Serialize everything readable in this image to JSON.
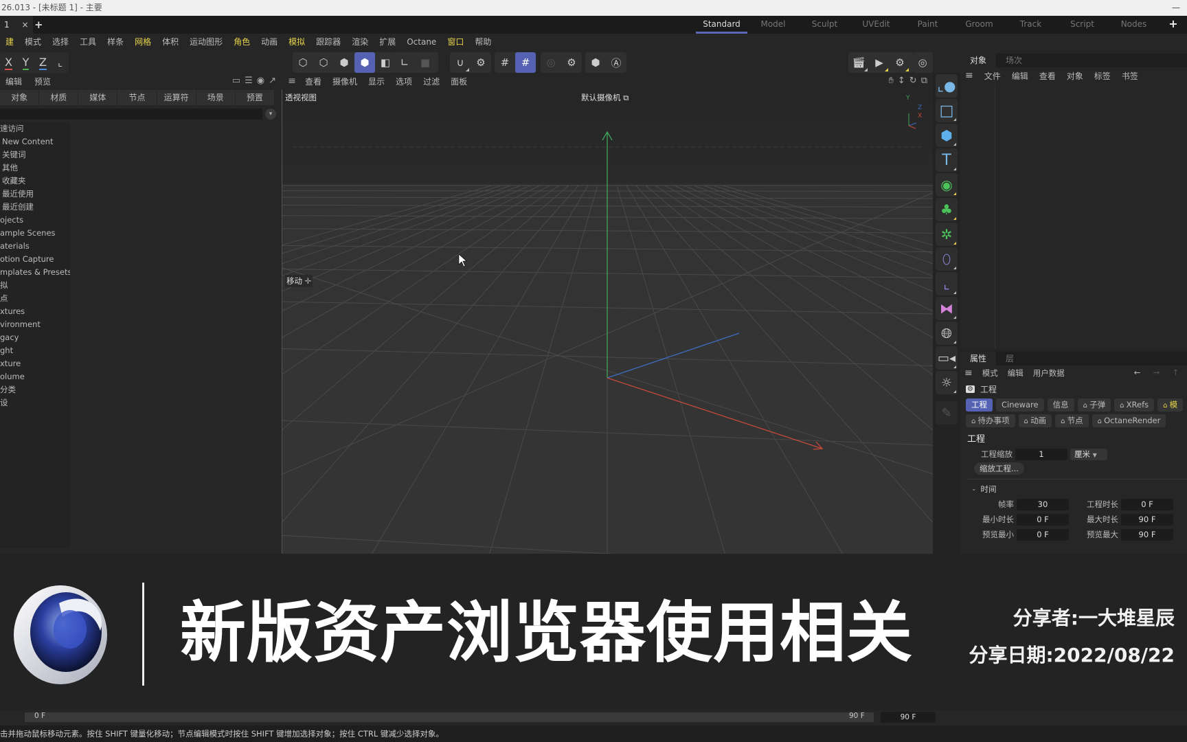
{
  "window": {
    "title": "26.013 - [未标题 1] - 主要",
    "minimize_glyph": "—"
  },
  "doc_tabs": {
    "active_label": "1",
    "close_glyph": "×",
    "add_glyph": "+"
  },
  "layouts": {
    "items": [
      "Standard",
      "Model",
      "Sculpt",
      "UVEdit",
      "Paint",
      "Groom",
      "Track",
      "Script",
      "Nodes"
    ],
    "active": "Standard",
    "add_glyph": "+"
  },
  "menubar": {
    "items": [
      {
        "label": "建",
        "highlight": true
      },
      {
        "label": "模式",
        "highlight": false
      },
      {
        "label": "选择",
        "highlight": false
      },
      {
        "label": "工具",
        "highlight": false
      },
      {
        "label": "样条",
        "highlight": false
      },
      {
        "label": "网格",
        "highlight": true
      },
      {
        "label": "体积",
        "highlight": false
      },
      {
        "label": "运动图形",
        "highlight": false
      },
      {
        "label": "角色",
        "highlight": true
      },
      {
        "label": "动画",
        "highlight": false
      },
      {
        "label": "模拟",
        "highlight": true
      },
      {
        "label": "跟踪器",
        "highlight": false
      },
      {
        "label": "渲染",
        "highlight": false
      },
      {
        "label": "扩展",
        "highlight": false
      },
      {
        "label": "Octane",
        "highlight": false
      },
      {
        "label": "窗口",
        "highlight": true
      },
      {
        "label": "帮助",
        "highlight": false
      }
    ]
  },
  "toolbar": {
    "axis_x": "X",
    "axis_y": "Y",
    "axis_z": "Z",
    "colors": {
      "x": "#d9534f",
      "y": "#4caf50",
      "z": "#4a8fe0",
      "accent": "#5562b3",
      "highlight": "#e6d24a"
    }
  },
  "asset_browser": {
    "menu": [
      "编辑",
      "预览"
    ],
    "tabs": [
      "对象",
      "材质",
      "媒体",
      "节点",
      "运算符",
      "场景",
      "预置"
    ],
    "search_placeholder": "",
    "tree": [
      {
        "label": "速访问",
        "indent": false
      },
      {
        "label": "New Content",
        "indent": true
      },
      {
        "label": "关键词",
        "indent": true
      },
      {
        "label": "其他",
        "indent": true
      },
      {
        "label": "收藏夹",
        "indent": true
      },
      {
        "label": "最近使用",
        "indent": true
      },
      {
        "label": "最近创建",
        "indent": true
      },
      {
        "label": "ojects",
        "indent": false
      },
      {
        "label": "ample Scenes",
        "indent": false
      },
      {
        "label": "aterials",
        "indent": false
      },
      {
        "label": "otion Capture",
        "indent": false
      },
      {
        "label": "mplates & Presets",
        "indent": false
      },
      {
        "label": "拟",
        "indent": false
      },
      {
        "label": "点",
        "indent": false
      },
      {
        "label": "xtures",
        "indent": false
      },
      {
        "label": "vironment",
        "indent": false
      },
      {
        "label": "gacy",
        "indent": false
      },
      {
        "label": "ght",
        "indent": false
      },
      {
        "label": "xture",
        "indent": false
      },
      {
        "label": "olume",
        "indent": false
      },
      {
        "label": "分类",
        "indent": false
      },
      {
        "label": "设",
        "indent": false
      }
    ]
  },
  "viewport": {
    "menu": [
      "查看",
      "摄像机",
      "显示",
      "选项",
      "过滤",
      "面板"
    ],
    "view_name": "透视视图",
    "camera": "默认摄像机",
    "tool_hint": "移动",
    "gizmo": {
      "y": "Y",
      "z": "Z",
      "x": "X"
    }
  },
  "object_manager": {
    "tabs": [
      "对象",
      "场次"
    ],
    "menu": [
      "文件",
      "编辑",
      "查看",
      "对象",
      "标签",
      "书签"
    ]
  },
  "attributes": {
    "tabs": [
      "属性",
      "层"
    ],
    "menu": [
      "模式",
      "编辑",
      "用户数据"
    ],
    "object_name": "工程",
    "chips_row1": [
      {
        "label": "工程",
        "active": true,
        "locked": false
      },
      {
        "label": "Cineware",
        "active": false,
        "locked": false
      },
      {
        "label": "信息",
        "active": false,
        "locked": false
      },
      {
        "label": "子弹",
        "active": false,
        "locked": true
      },
      {
        "label": "XRefs",
        "active": false,
        "locked": true
      },
      {
        "label": "模",
        "active": false,
        "locked": true,
        "yellow": true
      }
    ],
    "chips_row2": [
      {
        "label": "待办事项",
        "locked": true
      },
      {
        "label": "动画",
        "locked": true
      },
      {
        "label": "节点",
        "locked": true
      },
      {
        "label": "OctaneRender",
        "locked": true
      }
    ],
    "section_title": "工程",
    "project_scale_label": "工程缩放",
    "project_scale_value": "1",
    "project_scale_unit": "厘米",
    "scale_project_button": "缩放工程...",
    "time_group": "时间",
    "time_fields": [
      {
        "label": "帧率",
        "value": "30",
        "label2": "工程时长",
        "value2": "0 F"
      },
      {
        "label": "最小时长",
        "value": "0 F",
        "label2": "最大时长",
        "value2": "90 F"
      },
      {
        "label": "预览最小",
        "value": "0 F",
        "label2": "预览最大",
        "value2": "90 F"
      }
    ]
  },
  "banner": {
    "title": "新版资产浏览器使用相关",
    "sharer": "分享者:一大堆星辰",
    "date": "分享日期:2022/08/22"
  },
  "timeline": {
    "start": "0 F",
    "end": "90 F",
    "end_field": "90 F"
  },
  "statusbar": {
    "text": "击并拖动鼠标移动元素。按住 SHIFT 键量化移动；节点编辑模式时按住 SHIFT 键增加选择对象；按住 CTRL 键减少选择对象。"
  }
}
